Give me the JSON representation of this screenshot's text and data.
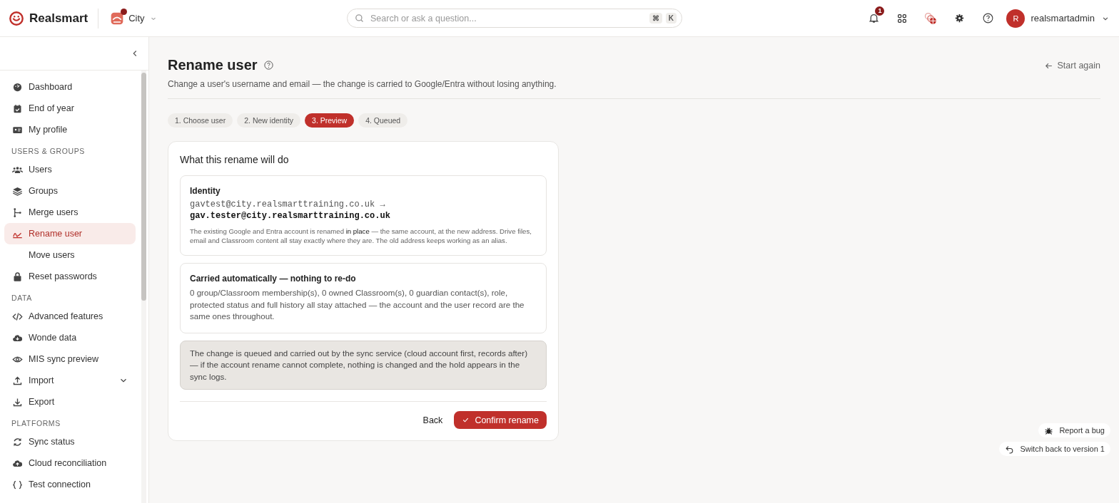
{
  "header": {
    "brand": "Realsmart",
    "school": "City",
    "search": {
      "placeholder": "Search or ask a question...",
      "shortcut": [
        "⌘",
        "K"
      ]
    },
    "notifications": "1",
    "avatar": "R",
    "username": "realsmartadmin"
  },
  "sidebar": {
    "items": [
      {
        "kind": "link",
        "label": "Dashboard",
        "selected": false,
        "expandable": false
      },
      {
        "kind": "link",
        "label": "End of year",
        "selected": false,
        "expandable": false
      },
      {
        "kind": "link",
        "label": "My profile",
        "selected": false,
        "expandable": false
      },
      {
        "kind": "heading",
        "label": "USERS & GROUPS"
      },
      {
        "kind": "link",
        "label": "Users",
        "selected": false,
        "expandable": false
      },
      {
        "kind": "link",
        "label": "Groups",
        "selected": false,
        "expandable": false
      },
      {
        "kind": "link",
        "label": "Merge users",
        "selected": false,
        "expandable": false
      },
      {
        "kind": "link",
        "label": "Rename user",
        "selected": true,
        "expandable": false
      },
      {
        "kind": "link",
        "label": "Move users",
        "selected": false,
        "expandable": false
      },
      {
        "kind": "link",
        "label": "Reset passwords",
        "selected": false,
        "expandable": false
      },
      {
        "kind": "heading",
        "label": "DATA"
      },
      {
        "kind": "link",
        "label": "Advanced features",
        "selected": false,
        "expandable": false
      },
      {
        "kind": "link",
        "label": "Wonde data",
        "selected": false,
        "expandable": false
      },
      {
        "kind": "link",
        "label": "MIS sync preview",
        "selected": false,
        "expandable": false
      },
      {
        "kind": "link",
        "label": "Import",
        "selected": false,
        "expandable": true
      },
      {
        "kind": "link",
        "label": "Export",
        "selected": false,
        "expandable": false
      },
      {
        "kind": "heading",
        "label": "PLATFORMS"
      },
      {
        "kind": "link",
        "label": "Sync status",
        "selected": false,
        "expandable": false
      },
      {
        "kind": "link",
        "label": "Cloud reconciliation",
        "selected": false,
        "expandable": false
      },
      {
        "kind": "link",
        "label": "Test connection",
        "selected": false,
        "expandable": false
      }
    ]
  },
  "page": {
    "title": "Rename user",
    "subtitle": "Change a user's username and email — the change is carried to Google/Entra without losing anything.",
    "start_again": "Start again"
  },
  "steps": [
    {
      "label": "1. Choose user",
      "selected": false
    },
    {
      "label": "2. New identity",
      "selected": false
    },
    {
      "label": "3. Preview",
      "selected": true
    },
    {
      "label": "4. Queued",
      "selected": false
    }
  ],
  "card": {
    "title": "What this rename will do",
    "identity": {
      "title": "Identity",
      "old_email": "gavtest@city.realsmarttraining.co.uk",
      "arrow": "→",
      "new_email": "gav.tester@city.realsmarttraining.co.uk",
      "note": "The existing Google and Entra account is renamed **in place** — the same account, at the new address. Drive files, email and Classroom content all stay exactly where they are. The old address keeps working as an alias."
    },
    "carried": {
      "title": "Carried automatically — nothing to re-do",
      "text": "0 group/Classroom membership(s), 0 owned Classroom(s), 0 guardian contact(s), role, protected status and full history all stay attached — the account and the user record are the same ones throughout."
    },
    "notice": "The change is queued and carried out by the sync service (cloud account first, records after) — if the account rename cannot complete, nothing is changed and the hold appears in the sync logs.",
    "back": "Back",
    "confirm": "Confirm rename"
  },
  "floating": [
    "Report a bug",
    "Switch back to version 1"
  ]
}
